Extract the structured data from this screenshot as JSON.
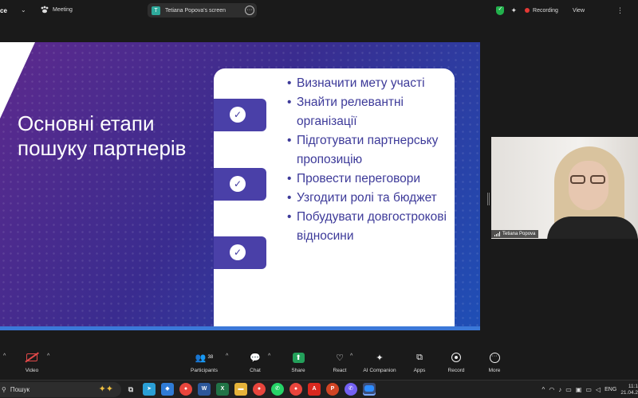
{
  "topbar": {
    "app_name": "ce",
    "meeting_label": "Meeting",
    "share_badge": "T",
    "share_label": "Tetiana Popova's screen",
    "recording_label": "Recording",
    "view_label": "View"
  },
  "slide": {
    "title": "Основні етапи пошуку партнерів",
    "bullets": [
      "Визначити мету участі",
      "Знайти релевантні організації",
      "Підготувати партнерську пропозицію",
      "Провести переговори",
      "Узгодити ролі та бюджет",
      "Побудувати довгострокові відносини"
    ],
    "colors": {
      "accent": "#3d3a99",
      "tab": "#4a40a8",
      "bg_start": "#5d2a8d",
      "bg_end": "#1f4fb6"
    }
  },
  "participant": {
    "name": "Tetiana Popova"
  },
  "controls": {
    "video": "Video",
    "participants": "Participants",
    "participants_count": "38",
    "chat": "Chat",
    "share": "Share",
    "react": "React",
    "ai_companion": "AI Companion",
    "apps": "Apps",
    "record": "Record",
    "more": "More"
  },
  "taskbar": {
    "search_placeholder": "Пошук",
    "language": "ENG",
    "time": "11:1",
    "date": "21.04.2"
  }
}
